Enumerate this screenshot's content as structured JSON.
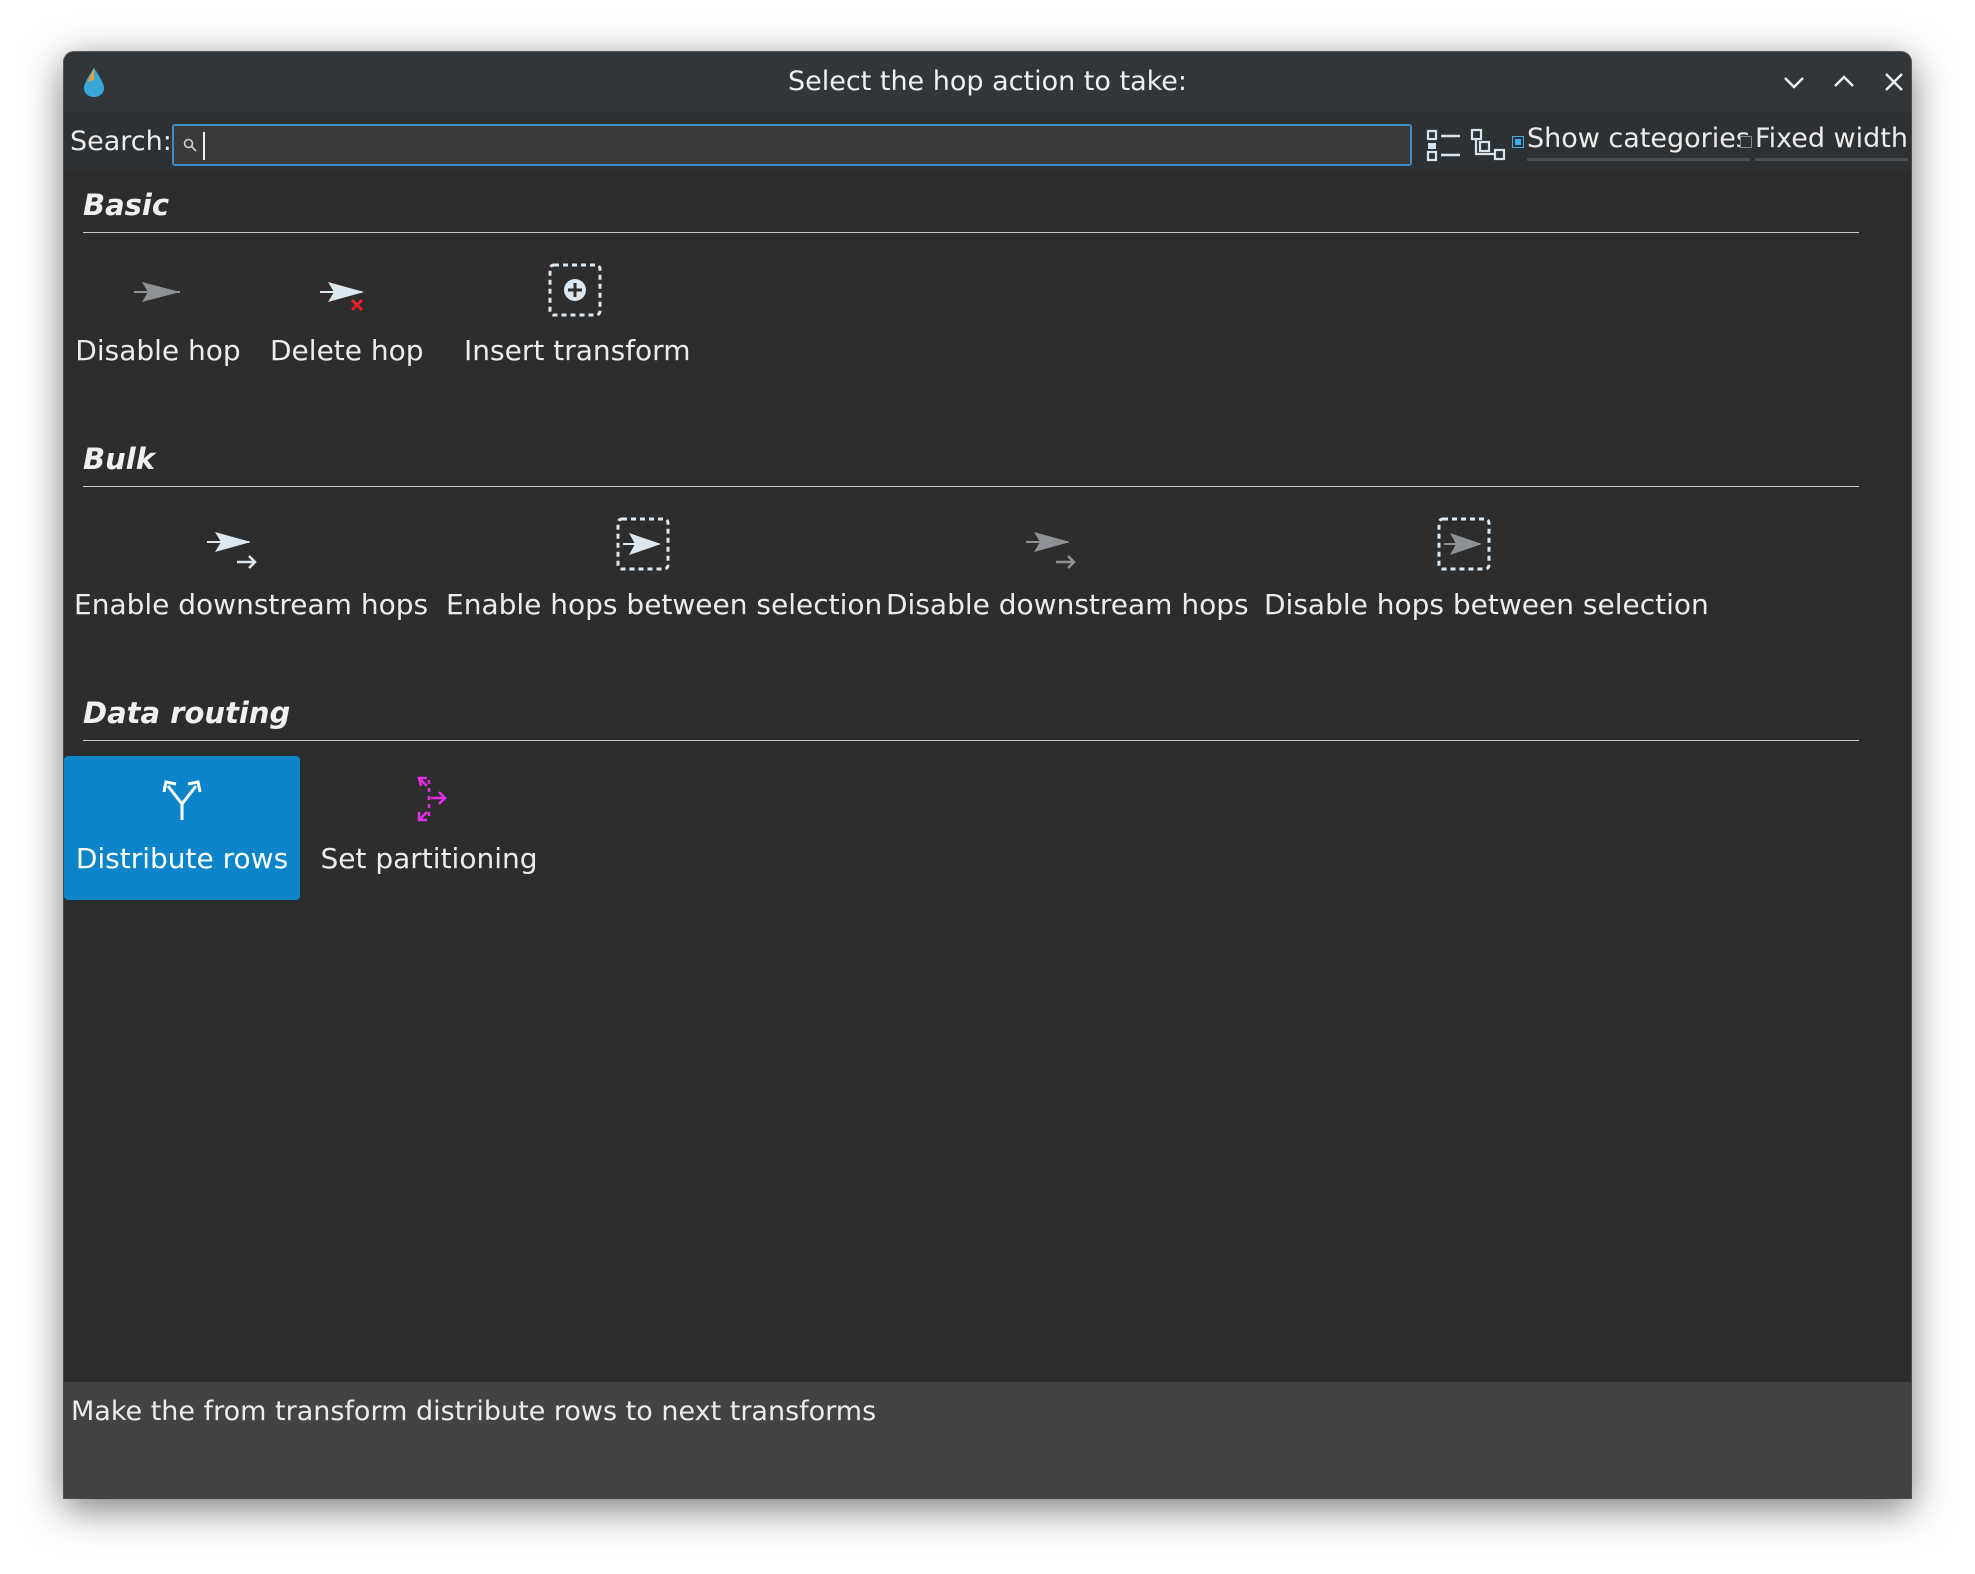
{
  "window": {
    "title": "Select the hop action to take:"
  },
  "titlebar_buttons": [
    {
      "name": "minimize",
      "icon": "chevron-down-icon"
    },
    {
      "name": "maximize",
      "icon": "chevron-up-icon"
    },
    {
      "name": "close",
      "icon": "close-icon"
    }
  ],
  "toolbar": {
    "search_label": "Search:",
    "search_value": "",
    "list_view_icon": "list-view-icon",
    "tree_view_icon": "tree-view-icon",
    "show_categories_label": "Show categories",
    "show_categories_checked": true,
    "fixed_width_label": "Fixed width",
    "fixed_width_checked": false
  },
  "categories": [
    {
      "name": "Basic",
      "items": [
        {
          "label": "Disable hop",
          "icon": "disable-hop-icon"
        },
        {
          "label": "Delete hop",
          "icon": "delete-hop-icon"
        },
        {
          "label": "Insert transform",
          "icon": "insert-transform-icon"
        }
      ]
    },
    {
      "name": "Bulk",
      "items": [
        {
          "label": "Enable downstream hops",
          "icon": "enable-downstream-icon"
        },
        {
          "label": "Enable hops between selection",
          "icon": "enable-between-icon"
        },
        {
          "label": "Disable downstream hops",
          "icon": "disable-downstream-icon"
        },
        {
          "label": "Disable hops between selection",
          "icon": "disable-between-icon"
        }
      ]
    },
    {
      "name": "Data routing",
      "items": [
        {
          "label": "Distribute rows",
          "icon": "distribute-rows-icon",
          "selected": true
        },
        {
          "label": "Set partitioning",
          "icon": "partitioning-icon"
        }
      ]
    }
  ],
  "status": {
    "text": "Make the from transform distribute rows to next transforms"
  },
  "colors": {
    "accent": "#0b84c9",
    "focus_border": "#3c8fc6",
    "delete_red": "#e0202a",
    "partition_magenta": "#e62ee6"
  }
}
